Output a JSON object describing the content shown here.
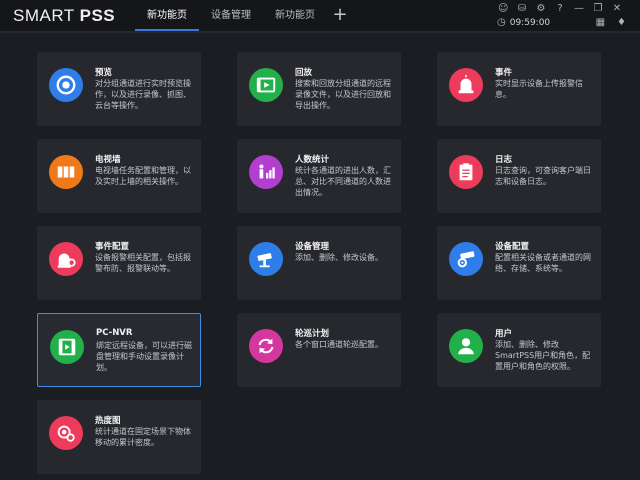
{
  "app": {
    "brand_plain": "SMART ",
    "brand_bold": "PSS"
  },
  "tabs": [
    {
      "label": "新功能页"
    },
    {
      "label": "设备管理"
    },
    {
      "label": "新功能页"
    }
  ],
  "add_tab_label": "+",
  "clock": "09:59:00",
  "cards": [
    {
      "title": "预览",
      "desc": "对分组通道进行实时预览操作，以及进行录像、抓图、云台等操作。",
      "color": "#2f7de8",
      "icon": "preview-icon"
    },
    {
      "title": "回放",
      "desc": "搜索和回放分组通道的远程录像文件，以及进行回放和导出操作。",
      "color": "#22b04a",
      "icon": "playback-icon"
    },
    {
      "title": "事件",
      "desc": "实时显示设备上传报警信息。",
      "color": "#ec3b5b",
      "icon": "alarm-light-icon"
    },
    {
      "title": "电视墙",
      "desc": "电视墙任务配置和管理，以及实时上墙的相关操作。",
      "color": "#f07a1a",
      "icon": "video-wall-icon"
    },
    {
      "title": "人数统计",
      "desc": "统计各通道的进出人数，汇总、对比不同通道的人数进出情况。",
      "color": "#b23fcf",
      "icon": "people-count-icon"
    },
    {
      "title": "日志",
      "desc": "日志查询，可查询客户端日志和设备日志。",
      "color": "#ec3b5b",
      "icon": "log-icon"
    },
    {
      "title": "事件配置",
      "desc": "设备报警相关配置，包括报警布防、报警联动等。",
      "color": "#ec3b5b",
      "icon": "event-config-icon"
    },
    {
      "title": "设备管理",
      "desc": "添加、删除、修改设备。",
      "color": "#2f7de8",
      "icon": "device-manage-icon"
    },
    {
      "title": "设备配置",
      "desc": "配置相关设备或者通道的网络、存储、系统等。",
      "color": "#2f7de8",
      "icon": "device-config-icon"
    },
    {
      "title": "PC-NVR",
      "desc": "绑定远程设备，可以进行磁盘管理和手动设置录像计划。",
      "color": "#22b04a",
      "icon": "pc-nvr-icon"
    },
    {
      "title": "轮巡计划",
      "desc": "各个窗口通道轮巡配置。",
      "color": "#d4389e",
      "icon": "tour-plan-icon"
    },
    {
      "title": "用户",
      "desc": "添加、删除、修改SmartPSS用户和角色，配置用户和角色的权限。",
      "color": "#22b04a",
      "icon": "user-icon"
    },
    {
      "title": "热度图",
      "desc": "统计通道在固定场景下物体移动的累计密度。",
      "color": "#ec3b5b",
      "icon": "heatmap-icon"
    }
  ]
}
